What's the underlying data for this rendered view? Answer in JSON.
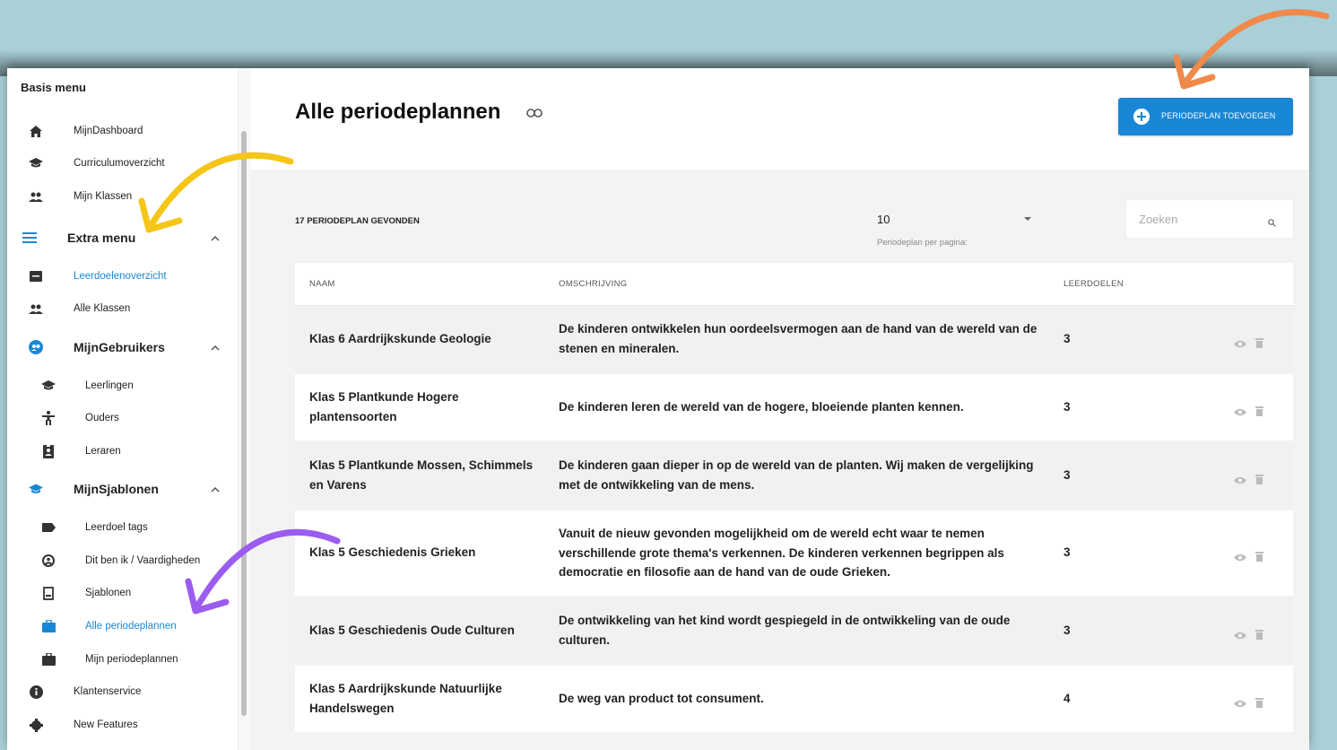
{
  "sidebar": {
    "title": "Basis menu",
    "items": [
      {
        "label": "MijnDashboard",
        "icon": "home-icon"
      },
      {
        "label": "Curriculumoverzicht",
        "icon": "graduation-cap-icon"
      },
      {
        "label": "Mijn Klassen",
        "icon": "people-icon"
      },
      {
        "label": "Extra menu",
        "icon": "menu-icon",
        "section": true
      },
      {
        "label": "Leerdoelenoverzicht",
        "icon": "list-icon",
        "active": true
      },
      {
        "label": "Alle Klassen",
        "icon": "people-icon"
      },
      {
        "label": "MijnGebruikers",
        "icon": "users-circle-icon",
        "section": true
      },
      {
        "label": "Leerlingen",
        "icon": "graduation-cap-icon"
      },
      {
        "label": "Ouders",
        "icon": "person-icon"
      },
      {
        "label": "Leraren",
        "icon": "id-badge-icon"
      },
      {
        "label": "MijnSjablonen",
        "icon": "graduation-cap-icon",
        "section": true
      },
      {
        "label": "Leerdoel tags",
        "icon": "tag-icon"
      },
      {
        "label": "Dit ben ik / Vaardigheden",
        "icon": "face-icon"
      },
      {
        "label": "Sjablonen",
        "icon": "document-icon"
      },
      {
        "label": "Alle periodeplannen",
        "icon": "briefcase-icon",
        "active": true
      },
      {
        "label": "Mijn periodeplannen",
        "icon": "briefcase-icon"
      },
      {
        "label": "Klantenservice",
        "icon": "info-icon"
      },
      {
        "label": "New Features",
        "icon": "gear-icon"
      }
    ]
  },
  "header": {
    "title": "Alle periodeplannen",
    "add_button": "PERIODEPLAN TOEVOEGEN"
  },
  "toolbar": {
    "found": "17 PERIODEPLAN GEVONDEN",
    "per_page_value": "10",
    "per_page_label": "Periodeplan per pagina:",
    "search_placeholder": "Zoeken"
  },
  "table": {
    "columns": [
      "NAAM",
      "OMSCHRIJVING",
      "LEERDOELEN"
    ],
    "rows": [
      {
        "naam": "Klas 6 Aardrijkskunde Geologie",
        "omschrijving": "De kinderen ontwikkelen hun oordeelsvermogen aan de hand van de wereld van de stenen en mineralen.",
        "leerdoelen": "3"
      },
      {
        "naam": "Klas 5 Plantkunde Hogere plantensoorten",
        "omschrijving": "De kinderen leren de wereld van de hogere, bloeiende planten kennen.",
        "leerdoelen": "3"
      },
      {
        "naam": "Klas 5 Plantkunde Mossen, Schimmels en Varens",
        "omschrijving": "De kinderen gaan dieper in op de wereld van de planten. Wij maken de vergelijking met de ontwikkeling van de mens.",
        "leerdoelen": "3"
      },
      {
        "naam": "Klas 5 Geschiedenis Grieken",
        "omschrijving": "Vanuit de nieuw gevonden mogelijkheid om de wereld echt waar te nemen verschillende grote thema's verkennen. De kinderen verkennen begrippen als democratie en filosofie aan de hand van de oude Grieken.",
        "leerdoelen": "3"
      },
      {
        "naam": "Klas 5 Geschiedenis Oude Culturen",
        "omschrijving": "De ontwikkeling van het kind wordt gespiegeld in de ontwikkeling van de oude culturen.",
        "leerdoelen": "3"
      },
      {
        "naam": "Klas 5 Aardrijkskunde Natuurlijke Handelswegen",
        "omschrijving": "De weg van product tot consument.",
        "leerdoelen": "4"
      }
    ]
  },
  "colors": {
    "accent": "#1a87d6",
    "background": "#a9d0d7",
    "arrow_yellow": "#f5c518",
    "arrow_orange": "#f08a4b",
    "arrow_purple": "#9b5cf0"
  }
}
